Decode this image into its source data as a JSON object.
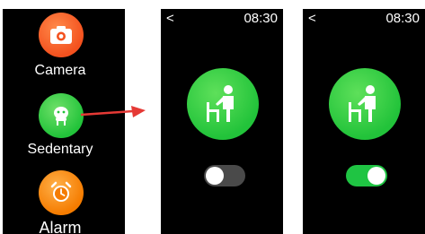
{
  "colors": {
    "accent_green": "#22c33a",
    "camera_orange": "#f4511e",
    "alarm_orange": "#f57c00",
    "arrow_red": "#e53935",
    "toggle_off": "#4a4a4a",
    "toggle_on": "#1fc443"
  },
  "menu": {
    "items": [
      {
        "label": "Camera",
        "icon": "camera-icon"
      },
      {
        "label": "Sedentary",
        "icon": "sedentary-icon"
      },
      {
        "label": "Alarm",
        "icon": "alarm-clock-icon"
      }
    ]
  },
  "screens": {
    "off": {
      "back": "<",
      "time": "08:30",
      "icon": "sedentary-person-icon",
      "toggle_on": false
    },
    "on": {
      "back": "<",
      "time": "08:30",
      "icon": "sedentary-person-icon",
      "toggle_on": true
    }
  }
}
